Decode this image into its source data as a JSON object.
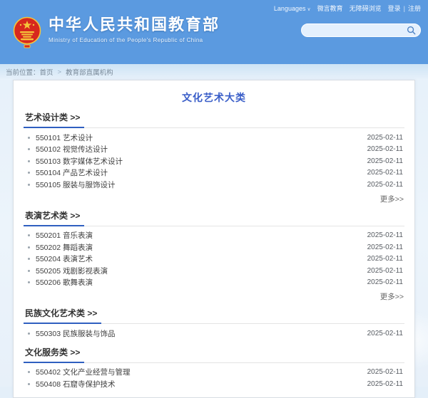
{
  "header": {
    "site_title": "中华人民共和国教育部",
    "site_subtitle": "Ministry of Education of the People's Republic of China",
    "top_links": {
      "languages_label": "Languages",
      "items": [
        "微言教育",
        "无障碍浏览",
        "登录",
        "注册"
      ],
      "divider": "|"
    },
    "search": {
      "value": "",
      "placeholder": ""
    }
  },
  "breadcrumb": {
    "label": "当前位置：",
    "home": "首页",
    "separator": ">",
    "current": "教育部直属机构"
  },
  "colors": {
    "accent_blue": "#3a5ec8",
    "underline_blue": "#2f5fc0",
    "sky_blue": "#5b9ae0",
    "emblem_red": "#d7281e",
    "emblem_gold": "#f5c53a"
  },
  "page": {
    "title": "文化艺术大类",
    "more_label": "更多>>",
    "sections": [
      {
        "title": "艺术设计类 >>",
        "has_more": true,
        "items": [
          {
            "code": "550101",
            "name": "艺术设计",
            "date": "2025-02-11"
          },
          {
            "code": "550102",
            "name": "视觉传达设计",
            "date": "2025-02-11"
          },
          {
            "code": "550103",
            "name": "数字媒体艺术设计",
            "date": "2025-02-11"
          },
          {
            "code": "550104",
            "name": "产品艺术设计",
            "date": "2025-02-11"
          },
          {
            "code": "550105",
            "name": "服装与服饰设计",
            "date": "2025-02-11"
          }
        ]
      },
      {
        "title": "表演艺术类 >>",
        "has_more": true,
        "items": [
          {
            "code": "550201",
            "name": "音乐表演",
            "date": "2025-02-11"
          },
          {
            "code": "550202",
            "name": "舞蹈表演",
            "date": "2025-02-11"
          },
          {
            "code": "550204",
            "name": "表演艺术",
            "date": "2025-02-11"
          },
          {
            "code": "550205",
            "name": "戏剧影视表演",
            "date": "2025-02-11"
          },
          {
            "code": "550206",
            "name": "歌舞表演",
            "date": "2025-02-11"
          }
        ]
      },
      {
        "title": "民族文化艺术类 >>",
        "has_more": false,
        "items": [
          {
            "code": "550303",
            "name": "民族服装与饰品",
            "date": "2025-02-11"
          }
        ]
      },
      {
        "title": "文化服务类 >>",
        "has_more": false,
        "items": [
          {
            "code": "550402",
            "name": "文化产业经营与管理",
            "date": "2025-02-11"
          },
          {
            "code": "550408",
            "name": "石窟寺保护技术",
            "date": "2025-02-11"
          }
        ]
      }
    ]
  }
}
